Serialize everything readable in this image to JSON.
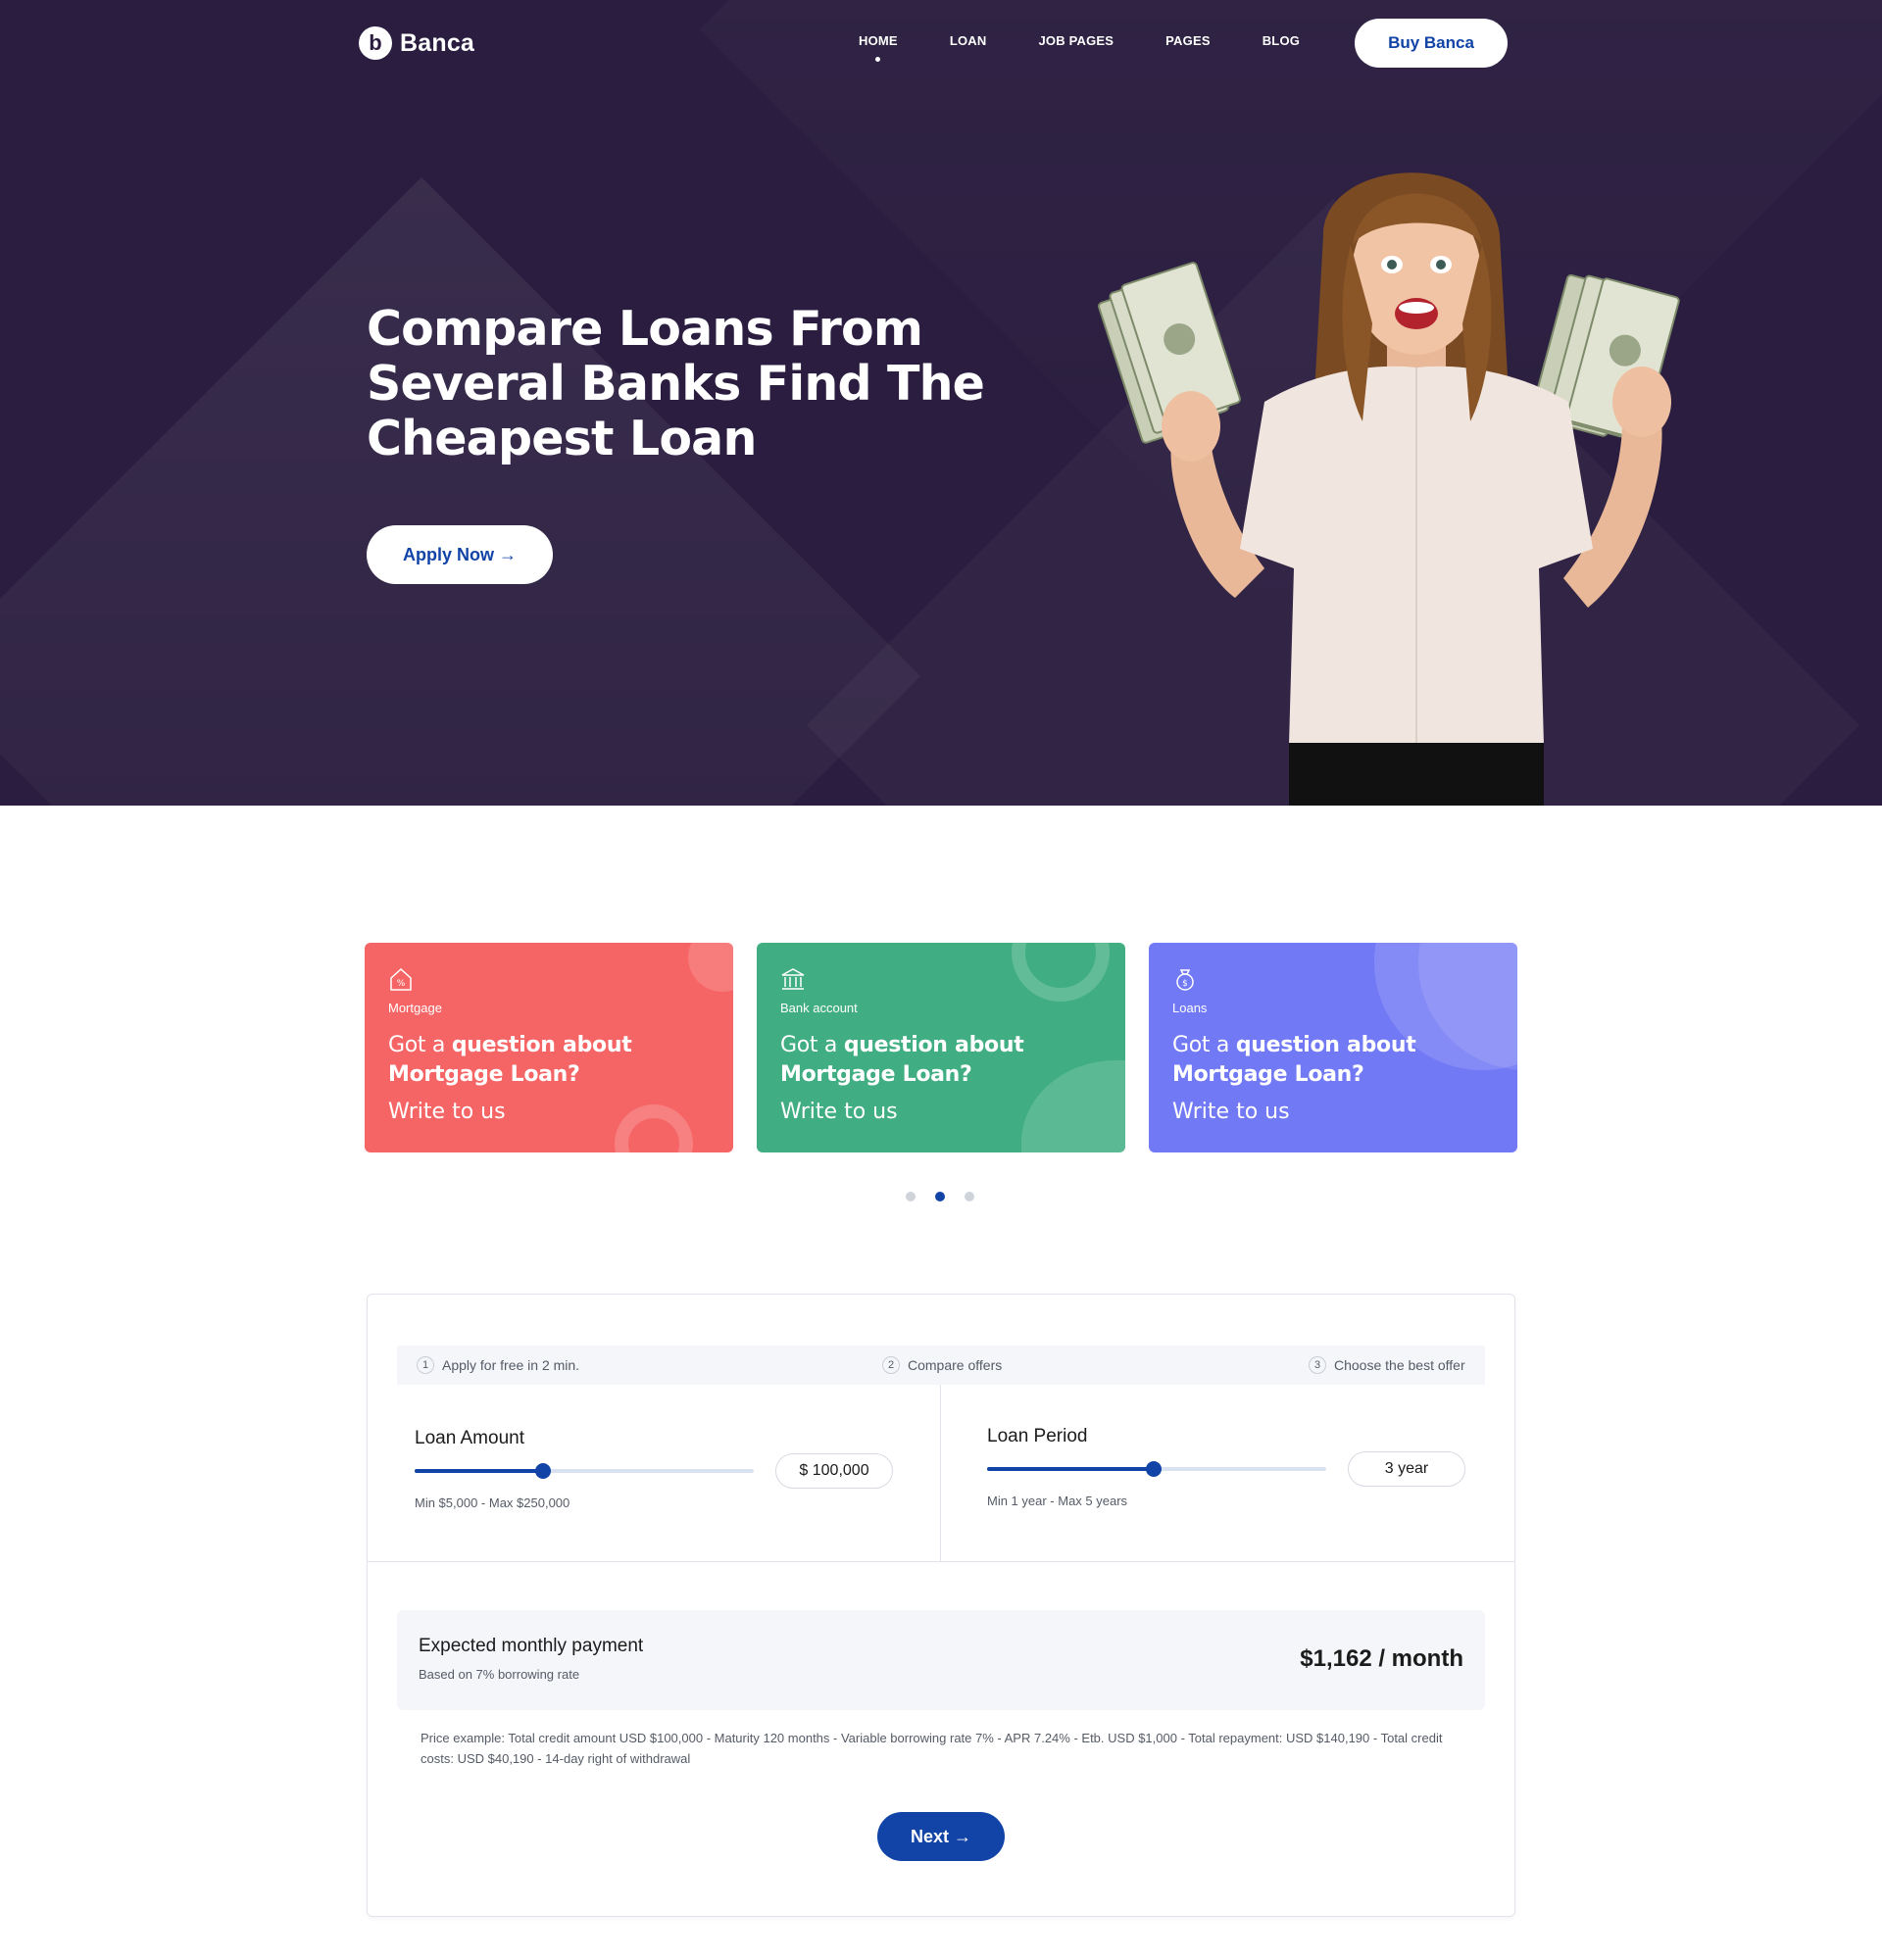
{
  "brand": {
    "name": "Banca",
    "logo_letter": "b"
  },
  "nav": {
    "items": [
      {
        "label": "HOME",
        "active": true
      },
      {
        "label": "LOAN",
        "active": false
      },
      {
        "label": "JOB PAGES",
        "active": false
      },
      {
        "label": "PAGES",
        "active": false
      },
      {
        "label": "BLOG",
        "active": false
      }
    ],
    "cta_label": "Buy Banca"
  },
  "hero": {
    "title": "Compare Loans From Several Banks Find The Cheapest Loan",
    "apply_label": "Apply Now →"
  },
  "cards": [
    {
      "category": "Mortgage",
      "question_lead": "Got a ",
      "question_bold": "question about Mortgage Loan?",
      "cta": "Write to us",
      "color": "#f66565",
      "icon": "house-percent-icon"
    },
    {
      "category": "Bank account",
      "question_lead": "Got a ",
      "question_bold": "question about Mortgage Loan?",
      "cta": "Write to us",
      "color": "#40ae82",
      "icon": "bank-building-icon"
    },
    {
      "category": "Loans",
      "question_lead": "Got a ",
      "question_bold": "question about Mortgage Loan?",
      "cta": "Write to us",
      "color": "#7179f5",
      "icon": "money-bag-icon"
    }
  ],
  "carousel": {
    "count": 3,
    "active_index": 1
  },
  "calculator": {
    "steps": [
      {
        "num": "1",
        "label": "Apply for free in 2 min."
      },
      {
        "num": "2",
        "label": "Compare offers"
      },
      {
        "num": "3",
        "label": "Choose the best offer"
      }
    ],
    "loan_amount": {
      "label": "Loan Amount",
      "value": "$ 100,000",
      "range_note": "Min $5,000 - Max $250,000",
      "slider_fraction": 0.38
    },
    "loan_period": {
      "label": "Loan Period",
      "value": "3 year",
      "range_note": "Min 1 year - Max 5 years",
      "slider_fraction": 0.49
    },
    "result": {
      "title": "Expected monthly payment",
      "subtitle": "Based on 7% borrowing rate",
      "value": "$1,162 / month"
    },
    "fine_print": "Price example: Total credit amount USD $100,000 - Maturity 120 months - Variable borrowing rate 7% - APR 7.24% - Etb. USD $1,000 - Total repayment: USD $140,190 - Total credit costs: USD $40,190 - 14-day right of withdrawal",
    "next_label": "Next →"
  },
  "colors": {
    "hero_bg": "#2a1d3f",
    "accent": "#1144a6"
  }
}
